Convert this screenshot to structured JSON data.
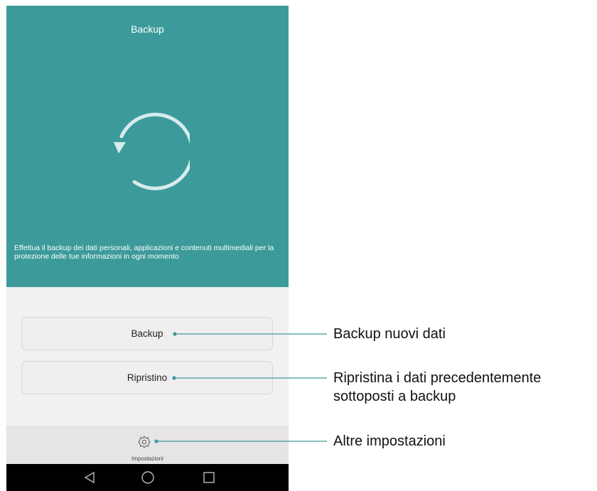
{
  "header": {
    "title": "Backup",
    "description": "Effettua il backup dei dati personali, applicazioni e contenuti multimediali per la protezione delle tue informazioni in ogni momento"
  },
  "buttons": {
    "backup_label": "Backup",
    "restore_label": "Ripristino"
  },
  "bottom_bar": {
    "settings_label": "Impostazioni",
    "settings_icon": "gear-icon"
  },
  "nav_bar": {
    "back_icon": "back-triangle-icon",
    "home_icon": "home-circle-icon",
    "recents_icon": "recents-square-icon"
  },
  "callouts": {
    "backup": "Backup nuovi dati",
    "restore_line1": "Ripristina i dati precedentemente",
    "restore_line2": "sottoposti a backup",
    "settings": "Altre impostazioni"
  },
  "colors": {
    "header_bg": "#3c9b9a",
    "callout_line": "#3c9b9a"
  }
}
